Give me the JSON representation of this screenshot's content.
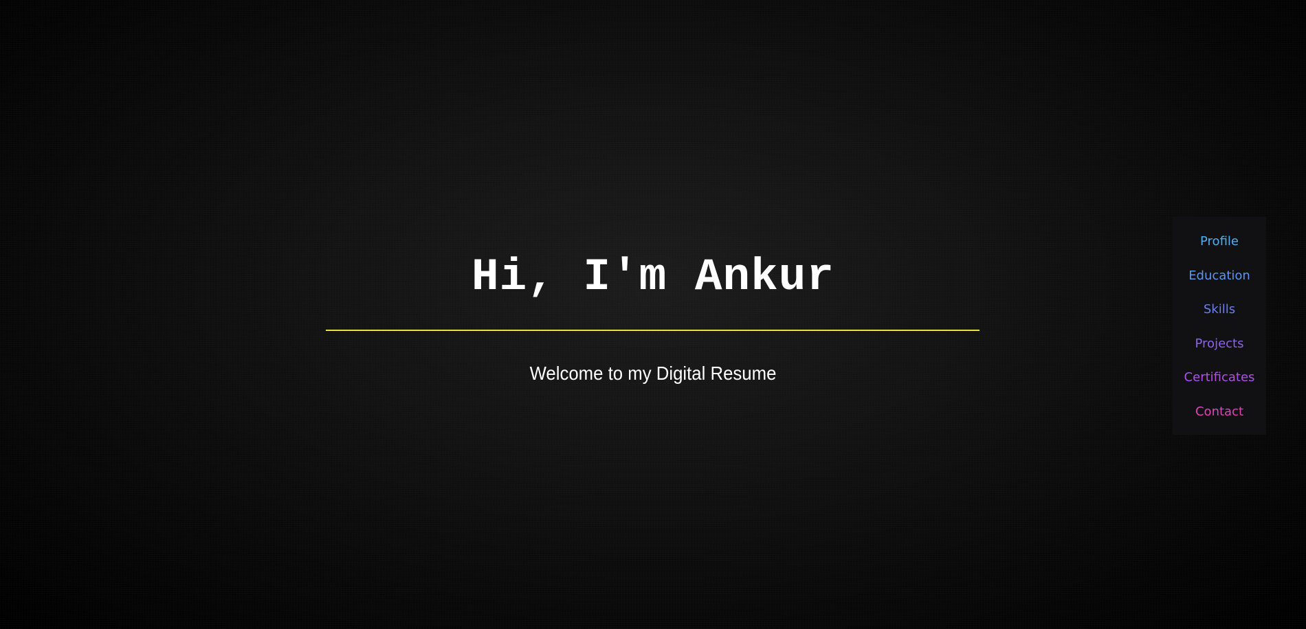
{
  "hero": {
    "title": "Hi, I'm Ankur",
    "subtitle": "Welcome to my Digital Resume",
    "divider_color": "#e6e63c"
  },
  "nav": {
    "items": [
      {
        "label": "Profile",
        "color": "#4fb0f0"
      },
      {
        "label": "Education",
        "color": "#5a96f2"
      },
      {
        "label": "Skills",
        "color": "#6a7ef2"
      },
      {
        "label": "Projects",
        "color": "#8c62ee"
      },
      {
        "label": "Certificates",
        "color": "#b050e8"
      },
      {
        "label": "Contact",
        "color": "#e044b8"
      }
    ]
  }
}
